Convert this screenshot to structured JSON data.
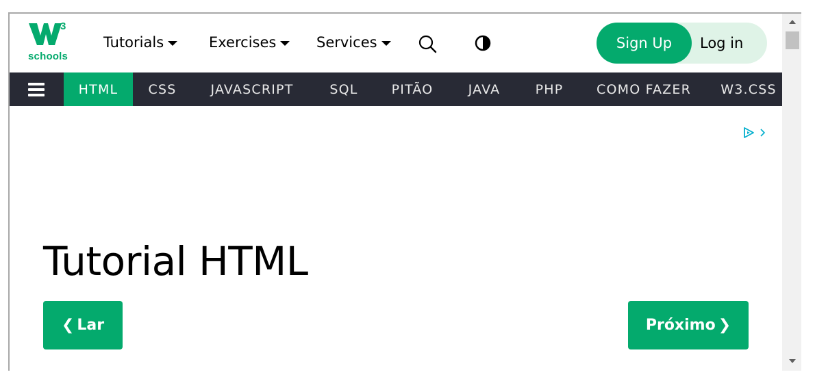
{
  "logo": {
    "superscript": "3",
    "text": "schools",
    "brand_color": "#04AA6D"
  },
  "topnav": {
    "tutorials": "Tutorials",
    "exercises": "Exercises",
    "services": "Services",
    "search_icon": "search-icon",
    "theme_icon": "contrast-icon"
  },
  "auth": {
    "signup": "Sign Up",
    "login": "Log in"
  },
  "subnav": {
    "items": [
      "HTML",
      "CSS",
      "JAVASCRIPT",
      "SQL",
      "PITÃO",
      "JAVA",
      "PHP",
      "COMO FAZER",
      "W3.CSS"
    ],
    "active": "HTML",
    "background": "#282A35",
    "active_color": "#04AA6D"
  },
  "main": {
    "title": "Tutorial HTML",
    "prev_label": "Lar",
    "next_label": "Próximo"
  }
}
